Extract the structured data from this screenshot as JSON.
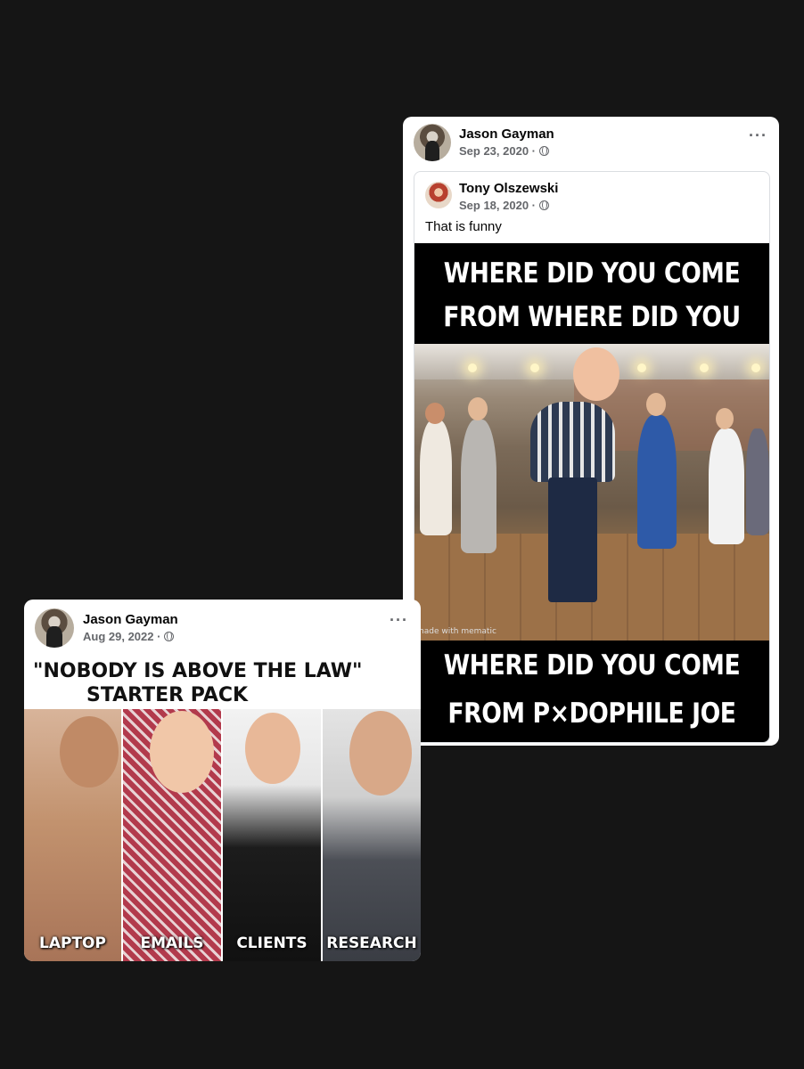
{
  "post_right": {
    "author": "Jason Gayman",
    "date": "Sep 23, 2020 ·",
    "more": "···",
    "shared": {
      "author": "Tony Olszewski",
      "date": "Sep 18, 2020 ·",
      "caption": "That is funny",
      "meme_top_line1": "WHERE DID YOU COME",
      "meme_top_line2": "FROM WHERE DID YOU GO",
      "meme_bottom_line1": "WHERE DID YOU COME",
      "meme_bottom_line2": "FROM P⨯DOPHILE JOE",
      "watermark": "made with mematic"
    }
  },
  "post_left": {
    "author": "Jason Gayman",
    "date": "Aug 29, 2022 ·",
    "more": "···",
    "title_line1": "\"NOBODY IS ABOVE THE LAW\"",
    "title_line2": "STARTER PACK",
    "panels": [
      {
        "label": "LAPTOP",
        "color": "#c89a78"
      },
      {
        "label": "EMAILS",
        "color": "#b8485a"
      },
      {
        "label": "CLIENTS",
        "color": "#2a2a2a"
      },
      {
        "label": "RESEARCH",
        "color": "#5a5e66"
      }
    ]
  }
}
